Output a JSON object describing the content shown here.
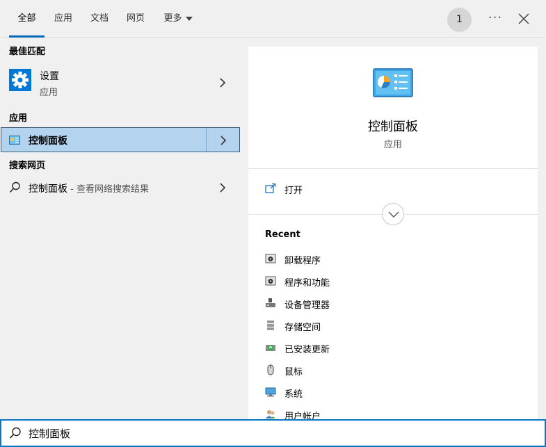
{
  "tabs": [
    {
      "label": "全部",
      "active": true
    },
    {
      "label": "应用"
    },
    {
      "label": "文档"
    },
    {
      "label": "网页"
    },
    {
      "label": "更多",
      "dropdown": true
    }
  ],
  "header": {
    "badge": "1",
    "more_icon": "ellipsis-icon",
    "close_icon": "close-icon"
  },
  "left": {
    "best_match": {
      "heading": "最佳匹配",
      "title": "设置",
      "subtitle": "应用",
      "icon": "gear-icon"
    },
    "apps": {
      "heading": "应用",
      "items": [
        {
          "label": "控制面板",
          "icon": "control-panel-icon",
          "selected": true
        }
      ]
    },
    "web": {
      "heading": "搜索网页",
      "query": "控制面板",
      "suffix": " - 查看网络搜索结果",
      "icon": "search-icon"
    }
  },
  "preview": {
    "title": "控制面板",
    "subtitle": "应用",
    "open_label": "打开",
    "recent_heading": "Recent",
    "recent": [
      {
        "label": "卸载程序",
        "icon": "programs-icon"
      },
      {
        "label": "程序和功能",
        "icon": "programs-icon"
      },
      {
        "label": "设备管理器",
        "icon": "device-manager-icon"
      },
      {
        "label": "存储空间",
        "icon": "storage-icon"
      },
      {
        "label": "已安装更新",
        "icon": "update-icon"
      },
      {
        "label": "鼠标",
        "icon": "mouse-icon"
      },
      {
        "label": "系统",
        "icon": "system-icon"
      },
      {
        "label": "用户帐户",
        "icon": "user-accounts-icon"
      }
    ]
  },
  "search": {
    "value": "控制面板",
    "icon": "search-icon"
  },
  "colors": {
    "accent": "#0067c0",
    "selected_bg": "#b3d3ef",
    "selected_border": "#3c5a7a",
    "search_border": "#0a77c6"
  }
}
